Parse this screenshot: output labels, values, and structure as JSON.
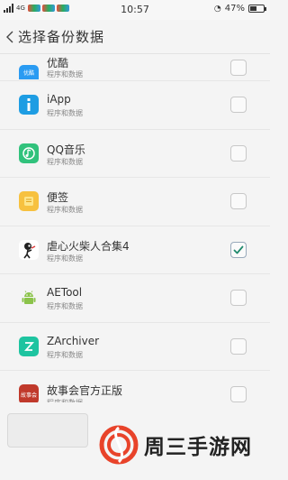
{
  "status_bar": {
    "network": "4G",
    "time": "10:57",
    "battery_text": "47%",
    "battery_level": 0.47
  },
  "header": {
    "title": "选择备份数据"
  },
  "apps": [
    {
      "name": "优酷",
      "subtitle": "程序和数据",
      "icon": "youku-icon",
      "color": "#2a9bf2",
      "checked": false
    },
    {
      "name": "iApp",
      "subtitle": "程序和数据",
      "icon": "iapp-icon",
      "color": "#1e9de3",
      "checked": false
    },
    {
      "name": "QQ音乐",
      "subtitle": "程序和数据",
      "icon": "qq-music-icon",
      "color": "#31c27c",
      "checked": false
    },
    {
      "name": "便签",
      "subtitle": "程序和数据",
      "icon": "notes-icon",
      "color": "#f7c13f",
      "checked": false
    },
    {
      "name": "虐心火柴人合集4",
      "subtitle": "程序和数据",
      "icon": "stickman-icon",
      "color": "#ffffff",
      "checked": true
    },
    {
      "name": "AETool",
      "subtitle": "程序和数据",
      "icon": "android-icon",
      "color": "#f4f4f4",
      "checked": false
    },
    {
      "name": "ZArchiver",
      "subtitle": "程序和数据",
      "icon": "zarchiver-icon",
      "color": "#1ec4a0",
      "checked": false
    },
    {
      "name": "故事会官方正版",
      "subtitle": "程序和数据",
      "icon": "gushihui-icon",
      "color": "#c0392b",
      "checked": false
    }
  ],
  "icon_labels": {
    "youku": "优酷",
    "gushihui": "故事会"
  },
  "watermark": {
    "text": "周三手游网"
  },
  "colors": {
    "check_accent": "#1f8a6d",
    "logo_red": "#e8432a"
  }
}
